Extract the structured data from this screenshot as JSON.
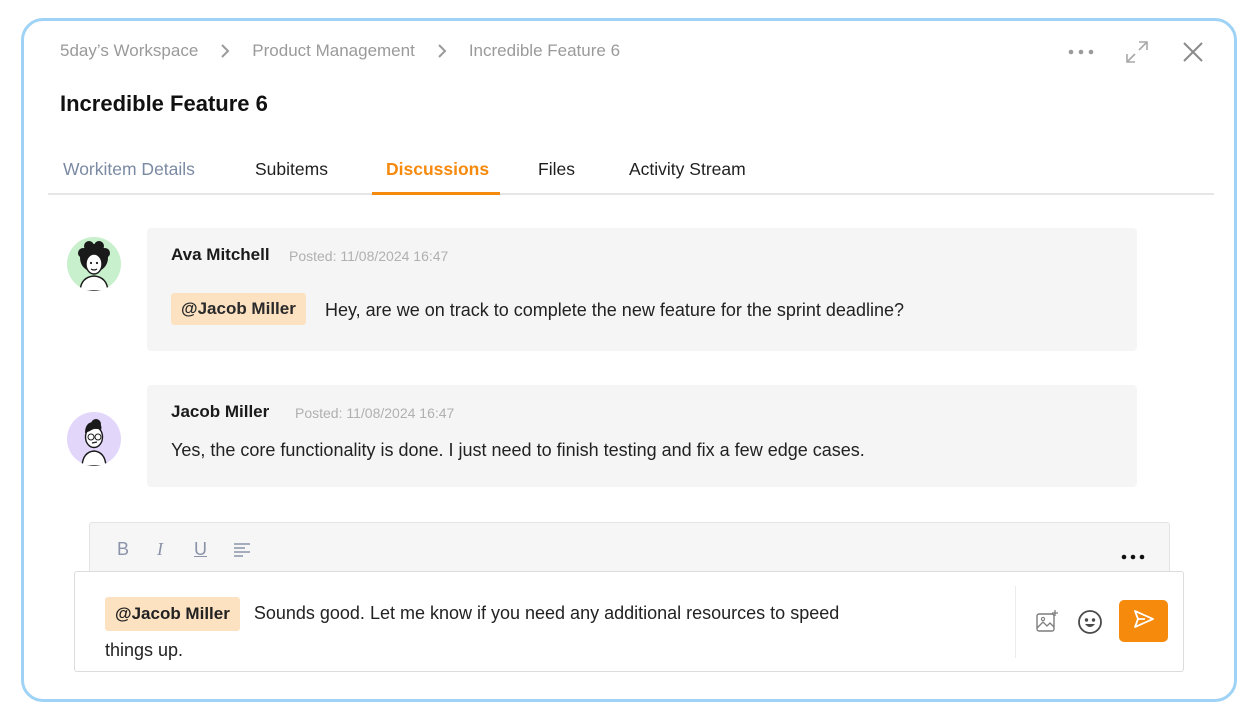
{
  "breadcrumb": {
    "items": [
      "5day’s Workspace",
      "Product Management",
      "Incredible Feature 6"
    ]
  },
  "header": {
    "title": "Incredible Feature 6",
    "icons": [
      "more-horizontal-icon",
      "expand-icon",
      "close-icon"
    ]
  },
  "tabs": [
    {
      "label": "Workitem Details"
    },
    {
      "label": "Subitems"
    },
    {
      "label": "Discussions",
      "active": true
    },
    {
      "label": "Files"
    },
    {
      "label": "Activity Stream"
    }
  ],
  "messages": [
    {
      "author": "Ava Mitchell",
      "posted": "Posted: 11/08/2024 16:47",
      "mention": "@Jacob Miller",
      "text": "Hey, are we on track to complete the new feature for the sprint deadline?"
    },
    {
      "author": "Jacob Miller",
      "posted": "Posted: 11/08/2024 16:47",
      "text": "Yes, the core functionality is done. I just need to finish testing and fix a few edge cases."
    }
  ],
  "composer": {
    "toolbar": {
      "bold": "B",
      "italic": "I",
      "underline": "U"
    },
    "mention": "@Jacob Miller",
    "value": "Sounds good. Let me know if you need any additional resources to speed things up."
  },
  "colors": {
    "accent": "#f58a0c",
    "mention_bg": "#fde2c2",
    "frame_border": "#9fd3f5"
  }
}
